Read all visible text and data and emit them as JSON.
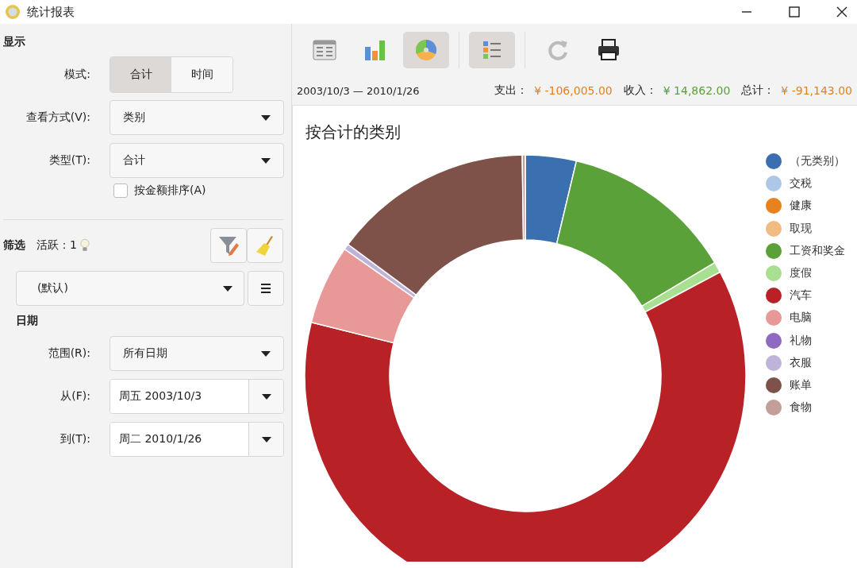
{
  "window": {
    "title": "统计报表"
  },
  "display": {
    "heading": "显示",
    "mode_label": "模式:",
    "modes": [
      {
        "label": "合计",
        "selected": true
      },
      {
        "label": "时间",
        "selected": false
      }
    ],
    "view_label": "查看方式(V):",
    "view_value": "类别",
    "type_label": "类型(T):",
    "type_value": "合计",
    "sort": {
      "label": "按金额排序(A)",
      "checked": false
    }
  },
  "filter": {
    "heading": "筛选",
    "active": "活跃：1",
    "preset": "(默认)"
  },
  "date": {
    "heading": "日期",
    "range_label": "范围(R):",
    "range_value": "所有日期",
    "from_label": "从(F):",
    "from_value": "周五 2003/10/3",
    "to_label": "到(T):",
    "to_value": "周二 2010/1/26"
  },
  "toolbar": [
    {
      "kind": "table",
      "selected": false
    },
    {
      "kind": "bar",
      "selected": false
    },
    {
      "kind": "pie",
      "selected": true
    },
    {
      "kind": "legend",
      "selected": true
    },
    {
      "kind": "refresh",
      "selected": false
    },
    {
      "kind": "print",
      "selected": false
    }
  ],
  "summary": {
    "period": "2003/10/3 — 2010/1/26",
    "expense_label": "支出：",
    "expense": "¥ -106,005.00",
    "income_label": "收入：",
    "income": "¥ 14,862.00",
    "total_label": "总计：",
    "total": "¥ -91,143.00"
  },
  "chart": {
    "title": "按合计的类别",
    "legend": [
      {
        "label": "（无类别）",
        "color": "#3a6fb0"
      },
      {
        "label": "交税",
        "color": "#aec7e8"
      },
      {
        "label": "健康",
        "color": "#e8821e"
      },
      {
        "label": "取现",
        "color": "#f2bb84"
      },
      {
        "label": "工资和奖金",
        "color": "#5aa13a"
      },
      {
        "label": "度假",
        "color": "#a8df90"
      },
      {
        "label": "汽车",
        "color": "#b82227"
      },
      {
        "label": "电脑",
        "color": "#e89896"
      },
      {
        "label": "礼物",
        "color": "#8e6bc0"
      },
      {
        "label": "衣服",
        "color": "#c0b3d9"
      },
      {
        "label": "账单",
        "color": "#7f5249"
      },
      {
        "label": "食物",
        "color": "#c2a099"
      }
    ]
  }
}
